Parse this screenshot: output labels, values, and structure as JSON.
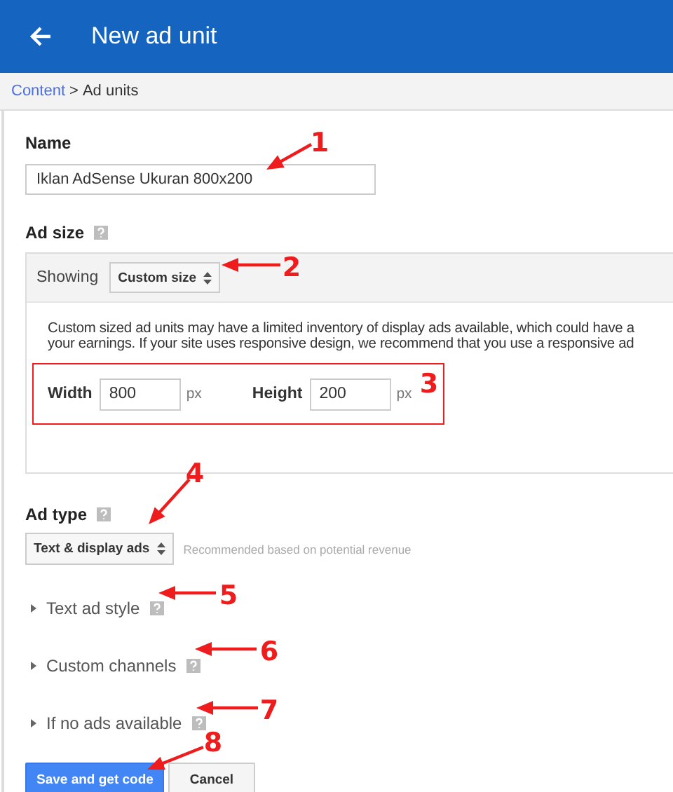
{
  "header": {
    "title": "New ad unit"
  },
  "breadcrumb": {
    "link": "Content",
    "separator": ">",
    "current": "Ad units"
  },
  "name_field": {
    "label": "Name",
    "value": "Iklan AdSense Ukuran 800x200"
  },
  "ad_size": {
    "label": "Ad size",
    "showing_label": "Showing",
    "select": "Custom size",
    "notice_lines": [
      "Custom sized ad units may have a limited inventory of display ads available, which could have a",
      "your earnings. If your site uses responsive design, we recommend that you use a responsive ad"
    ],
    "width_label": "Width",
    "width_value": "800",
    "width_unit": "px",
    "height_label": "Height",
    "height_value": "200",
    "height_unit": "px"
  },
  "ad_type": {
    "label": "Ad type",
    "select": "Text & display ads",
    "hint": "Recommended based on potential revenue"
  },
  "sections": [
    {
      "label": "Text ad style",
      "expanded": false
    },
    {
      "label": "Custom channels",
      "expanded": false
    },
    {
      "label": "If no ads available",
      "expanded": false
    }
  ],
  "buttons": [
    {
      "label": "Save and get code",
      "kind": "primary"
    },
    {
      "label": "Cancel",
      "kind": "secondary"
    }
  ],
  "annotations": [
    "1",
    "2",
    "3",
    "4",
    "5",
    "6",
    "7",
    "8"
  ]
}
